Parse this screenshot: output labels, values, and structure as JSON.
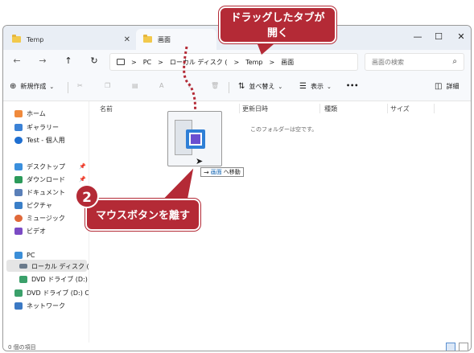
{
  "tabs": [
    {
      "label": "Temp",
      "active": false
    },
    {
      "label": "画面",
      "active": true
    }
  ],
  "window_controls": {
    "minimize": "—",
    "maximize": "☐",
    "close": "✕"
  },
  "address": {
    "segments": [
      "PC",
      "ローカル ディスク (",
      "Temp",
      "画面"
    ],
    "separators": ">"
  },
  "search": {
    "placeholder": "画面の検索"
  },
  "commands": {
    "new": "新規作成",
    "sort": "並べ替え",
    "view": "表示",
    "more": "•••",
    "details": "詳細"
  },
  "nav": {
    "home": "ホーム",
    "gallery": "ギャラリー",
    "onedrive": "Test - 個人用",
    "desktop": "デスクトップ",
    "downloads": "ダウンロード",
    "documents": "ドキュメント",
    "pictures": "ピクチャ",
    "music": "ミュージック",
    "videos": "ビデオ",
    "pc": "PC",
    "local_disk": "ローカル ディスク (C:)",
    "dvd1": "DVD ドライブ (D:) CCC",
    "dvd2": "DVD ドライブ (D:) CCCC",
    "network": "ネットワーク"
  },
  "columns": [
    "名前",
    "更新日時",
    "種類",
    "サイズ"
  ],
  "empty_message": "このフォルダーは空です。",
  "status": {
    "item_count": "0 個の項目"
  },
  "annotations": {
    "callout1_line1": "ドラッグしたタブが",
    "callout1_line2": "開く",
    "step_number": "2",
    "callout2": "マウスボタンを離す",
    "drag_tip_arrow": "→",
    "drag_tip_target": "画面",
    "drag_tip_action": "へ移動"
  },
  "colors": {
    "accent": "#b42a36",
    "folder": "#f2c94c",
    "link": "#0a5fb0"
  }
}
